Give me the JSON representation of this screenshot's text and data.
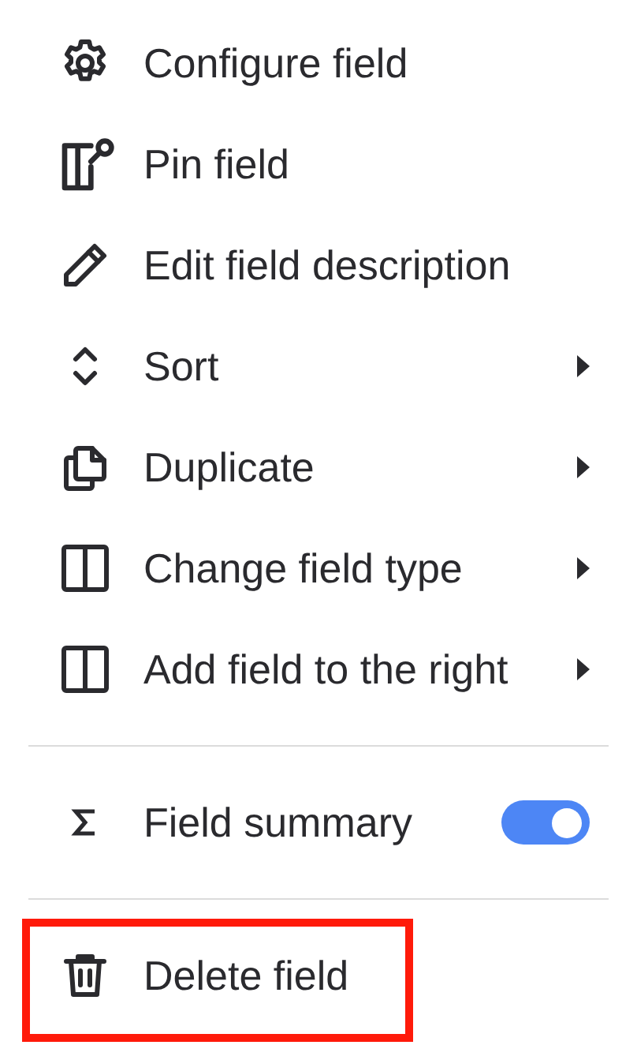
{
  "menu": {
    "items": [
      {
        "kind": "action",
        "label": "Configure field",
        "highlighted": false
      },
      {
        "kind": "action",
        "label": "Pin field",
        "highlighted": false
      },
      {
        "kind": "action",
        "label": "Edit field description",
        "highlighted": false
      },
      {
        "kind": "submenu",
        "label": "Sort",
        "highlighted": false
      },
      {
        "kind": "submenu",
        "label": "Duplicate",
        "highlighted": false
      },
      {
        "kind": "submenu",
        "label": "Change field type",
        "highlighted": false
      },
      {
        "kind": "submenu",
        "label": "Add field to the right",
        "highlighted": false
      },
      {
        "kind": "divider"
      },
      {
        "kind": "toggle",
        "label": "Field summary",
        "on": true,
        "highlighted": false
      },
      {
        "kind": "divider"
      },
      {
        "kind": "action",
        "label": "Delete field",
        "highlighted": true
      }
    ]
  }
}
